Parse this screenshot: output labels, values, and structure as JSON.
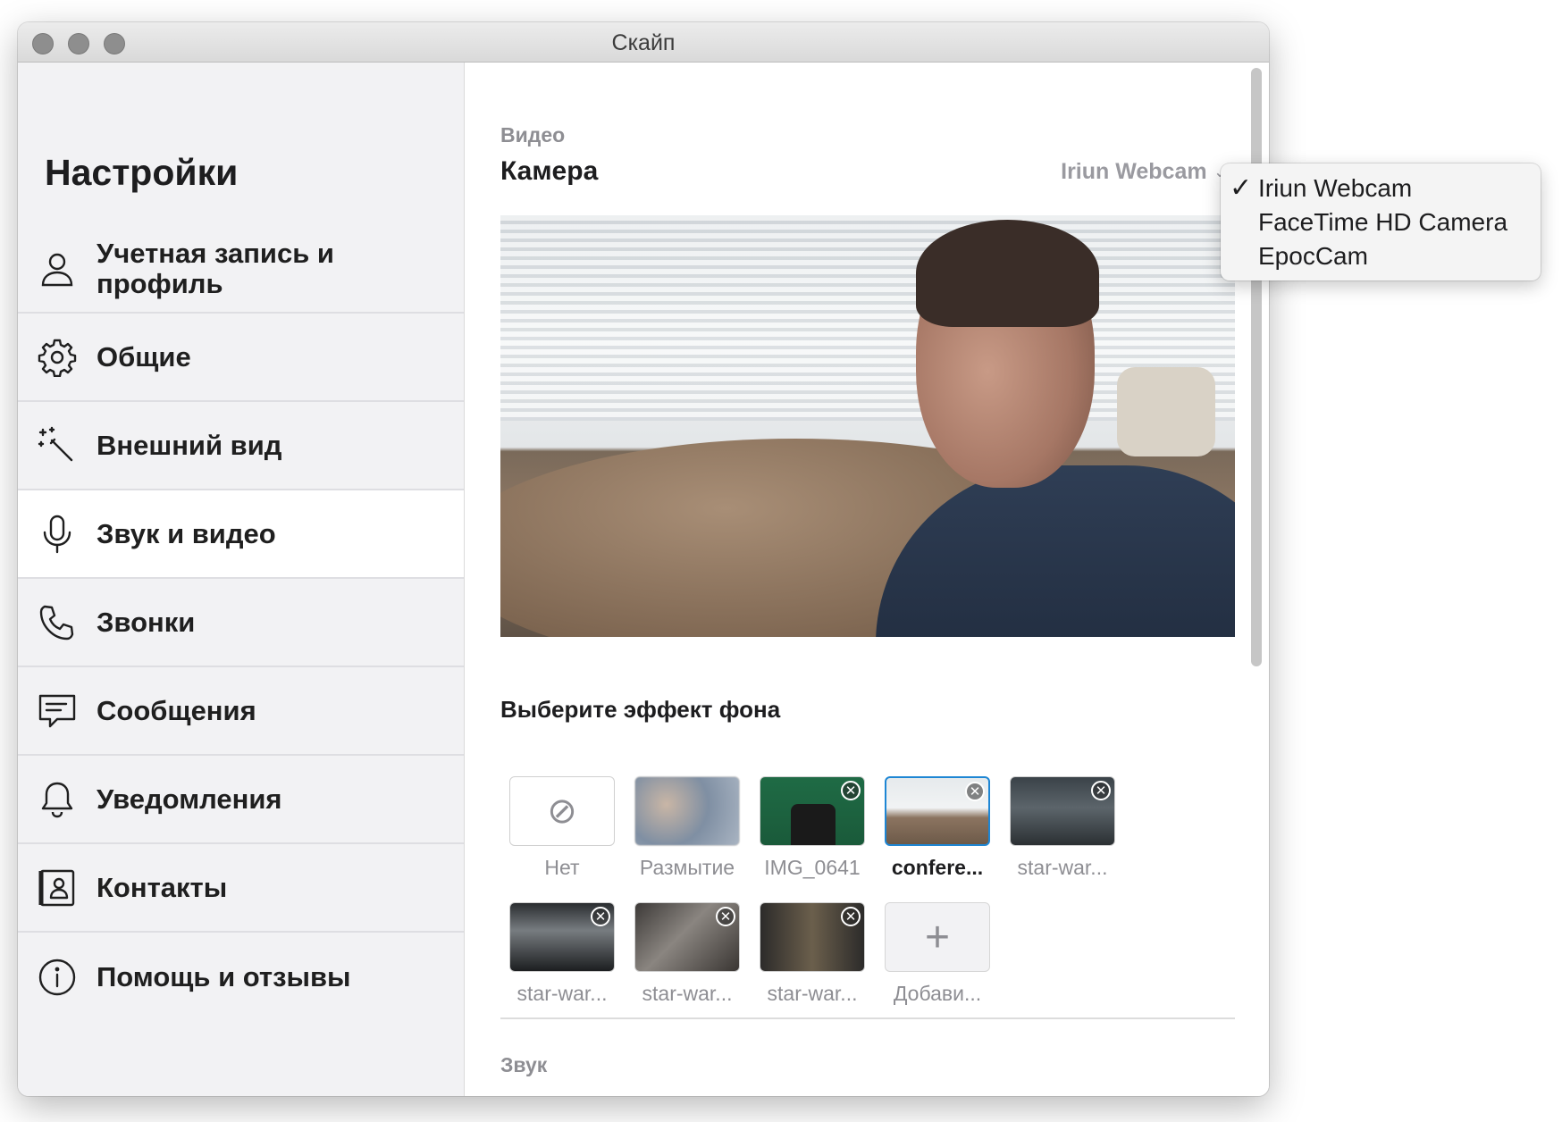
{
  "window": {
    "title": "Скайп"
  },
  "sidebar": {
    "title": "Настройки",
    "items": [
      {
        "label": "Учетная запись и профиль",
        "icon": "person-icon",
        "active": false
      },
      {
        "label": "Общие",
        "icon": "gear-icon",
        "active": false
      },
      {
        "label": "Внешний вид",
        "icon": "magic-wand-icon",
        "active": false
      },
      {
        "label": "Звук и видео",
        "icon": "microphone-icon",
        "active": true
      },
      {
        "label": "Звонки",
        "icon": "phone-icon",
        "active": false
      },
      {
        "label": "Сообщения",
        "icon": "message-icon",
        "active": false
      },
      {
        "label": "Уведомления",
        "icon": "bell-icon",
        "active": false
      },
      {
        "label": "Контакты",
        "icon": "contacts-icon",
        "active": false
      },
      {
        "label": "Помощь и отзывы",
        "icon": "info-icon",
        "active": false
      }
    ]
  },
  "video": {
    "section_title": "Видео",
    "camera_label": "Камера",
    "camera_selected": "Iriun Webcam",
    "background_title": "Выберите эффект фона",
    "backgrounds": [
      {
        "label": "Нет",
        "kind": "none",
        "removable": false,
        "selected": false
      },
      {
        "label": "Размытие",
        "kind": "blur",
        "removable": false,
        "selected": false
      },
      {
        "label": "IMG_0641",
        "kind": "image",
        "removable": true,
        "selected": false
      },
      {
        "label": "confere...",
        "kind": "image",
        "removable": true,
        "selected": true
      },
      {
        "label": "star-war...",
        "kind": "image",
        "removable": true,
        "selected": false
      },
      {
        "label": "star-war...",
        "kind": "image",
        "removable": true,
        "selected": false
      },
      {
        "label": "star-war...",
        "kind": "image",
        "removable": true,
        "selected": false
      },
      {
        "label": "star-war...",
        "kind": "image",
        "removable": true,
        "selected": false
      },
      {
        "label": "Добави...",
        "kind": "add",
        "removable": false,
        "selected": false
      }
    ]
  },
  "audio": {
    "section_title": "Звук"
  },
  "camera_dropdown": {
    "options": [
      "Iriun Webcam",
      "FaceTime HD Camera",
      "EpocCam"
    ],
    "checked_index": 0
  },
  "colors": {
    "accent": "#1e86d4",
    "muted": "#8e8e93",
    "sidebar_bg": "#f2f2f4"
  }
}
